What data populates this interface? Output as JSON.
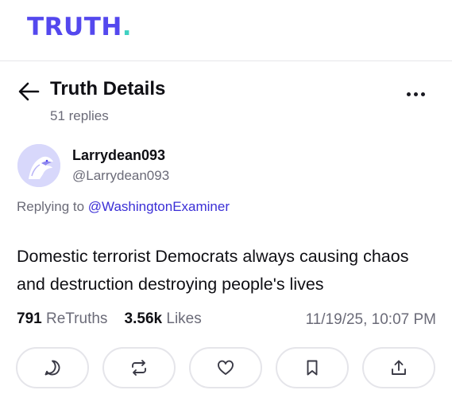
{
  "app": {
    "logo_main": "TRUTH",
    "logo_dot": ".",
    "brand_color": "#5448ee",
    "accent_color": "#3fd1c2"
  },
  "header": {
    "title": "Truth Details",
    "subtitle": "51 replies",
    "back_icon": "arrow-left-icon",
    "more_icon": "more-horizontal-icon"
  },
  "post": {
    "author_name": "Larrydean093",
    "author_handle": "@Larrydean093",
    "avatar_icon": "eagle-avatar-icon",
    "replying_prefix": "Replying to",
    "replying_to": "@WashingtonExaminer",
    "text": "Domestic terrorist Democrats always causing chaos and destruction destroying people's lives",
    "retruths_count": "791",
    "retruths_label": "ReTruths",
    "likes_count": "3.56k",
    "likes_label": "Likes",
    "timestamp": "11/19/25, 10:07 PM"
  },
  "actions": [
    {
      "name": "reply",
      "icon": "reply-icon"
    },
    {
      "name": "retruth",
      "icon": "retruth-icon"
    },
    {
      "name": "like",
      "icon": "heart-icon"
    },
    {
      "name": "bookmark",
      "icon": "bookmark-icon"
    },
    {
      "name": "share",
      "icon": "share-icon"
    }
  ]
}
